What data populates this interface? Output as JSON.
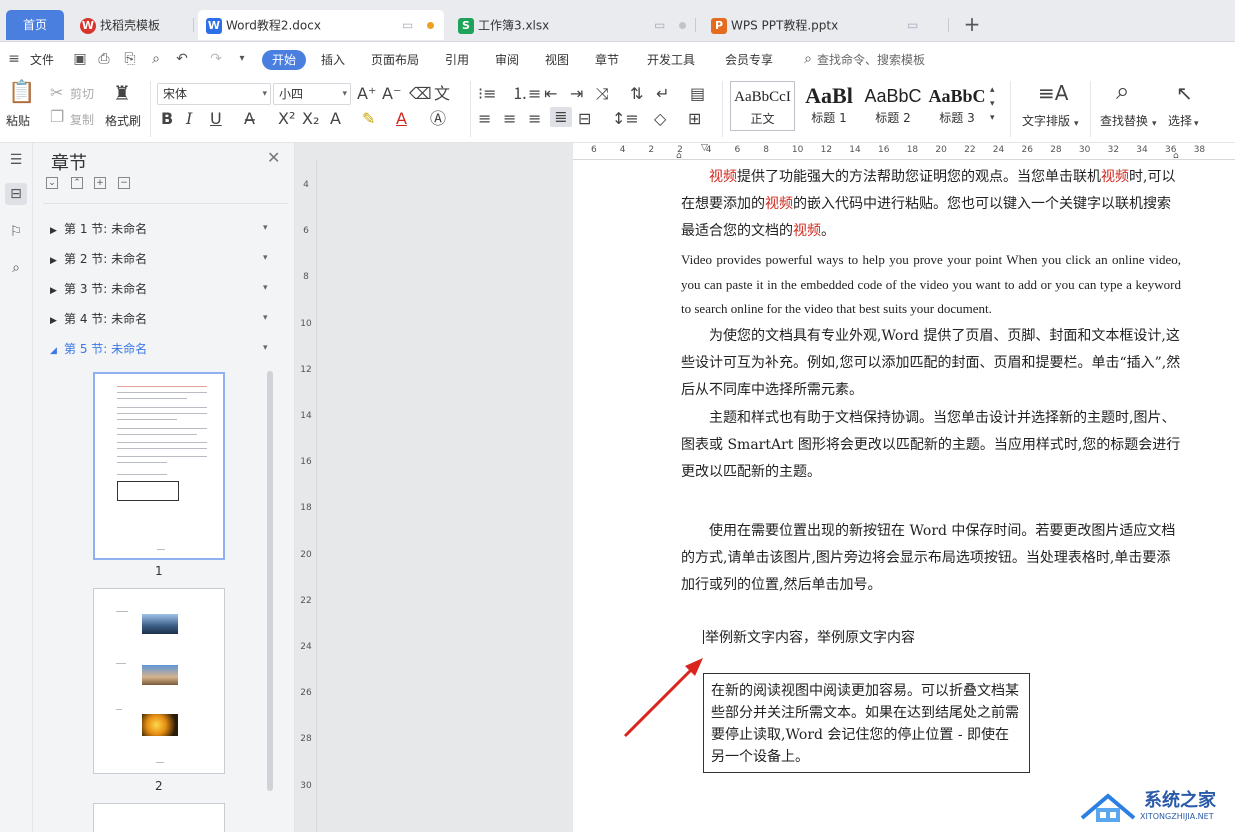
{
  "tabs": {
    "home": "首页",
    "items": [
      {
        "label": "找稻壳模板",
        "icon": "W",
        "color": "#d9342b"
      },
      {
        "label": "Word教程2.docx",
        "icon": "W",
        "color": "#2d6fe6"
      },
      {
        "label": "工作簿3.xlsx",
        "icon": "S",
        "color": "#1ea35b"
      },
      {
        "label": "WPS PPT教程.pptx",
        "icon": "P",
        "color": "#e56b1f"
      }
    ],
    "new_tab": "+"
  },
  "menu": {
    "file": "文件",
    "items": [
      "开始",
      "插入",
      "页面布局",
      "引用",
      "审阅",
      "视图",
      "章节",
      "开发工具",
      "会员专享"
    ],
    "search_placeholder": "查找命令、搜索模板"
  },
  "ribbon": {
    "paste": "粘贴",
    "cut": "剪切",
    "copy": "复制",
    "format_painter": "格式刷",
    "font_name": "宋体",
    "font_size": "小四",
    "styles": [
      {
        "sample": "AaBbCcI",
        "name": "正文"
      },
      {
        "sample": "AaBl",
        "name": "标题 1"
      },
      {
        "sample": "AaBbC",
        "name": "标题 2"
      },
      {
        "sample": "AaBbC",
        "name": "标题 3"
      }
    ],
    "text_layout": "文字排版",
    "find_replace": "查找替换",
    "select": "选择"
  },
  "panel": {
    "title": "章节",
    "sections": [
      "第 1 节: 未命名",
      "第 2 节: 未命名",
      "第 3 节: 未命名",
      "第 4 节: 未命名",
      "第 5 节: 未命名"
    ],
    "current_section": 5,
    "pages": [
      "1",
      "2"
    ]
  },
  "ruler": {
    "h_ticks": [
      "6",
      "4",
      "2",
      "2",
      "4",
      "6",
      "8",
      "10",
      "12",
      "14",
      "16",
      "18",
      "20",
      "22",
      "24",
      "26",
      "28",
      "30",
      "32",
      "34",
      "36",
      "38"
    ],
    "v_ticks": [
      "4",
      "6",
      "8",
      "10",
      "12",
      "14",
      "16",
      "18",
      "20",
      "22",
      "24",
      "26",
      "28",
      "30"
    ]
  },
  "document": {
    "p1_parts": [
      "视频",
      "提供了功能强大的方法帮助您证明您的观点。当您单击联机",
      "视频",
      "时,可以在想要添加的",
      "视频",
      "的嵌入代码中进行粘贴。您也可以键入一个关键字以联机搜索最适合您的文档的",
      "视频",
      "。"
    ],
    "p2": "Video provides powerful ways to help you prove your point When you click an online video, you can paste it in the embedded code of the video you want to add or you can type a keyword to search online for the video that best suits your document.",
    "p3": "为使您的文档具有专业外观,Word 提供了页眉、页脚、封面和文本框设计,这些设计可互为补充。例如,您可以添加匹配的封面、页眉和提要栏。单击“插入”,然后从不同库中选择所需元素。",
    "p4": "主题和样式也有助于文档保持协调。当您单击设计并选择新的主题时,图片、图表或 SmartArt 图形将会更改以匹配新的主题。当应用样式时,您的标题会进行更改以匹配新的主题。",
    "p5": "使用在需要位置出现的新按钮在 Word 中保存时间。若要更改图片适应文档的方式,请单击该图片,图片旁边将会显示布局选项按钮。当处理表格时,单击要添加行或列的位置,然后单击加号。",
    "new_line": "举例新文字内容，举例原文字内容",
    "textbox": "在新的阅读视图中阅读更加容易。可以折叠文档某些部分并关注所需文本。如果在达到结尾处之前需要停止读取,Word 会记住您的停止位置 - 即使在另一个设备上。"
  },
  "watermark": {
    "title": "系统之家",
    "url": "XITONGZHIJIA.NET"
  }
}
